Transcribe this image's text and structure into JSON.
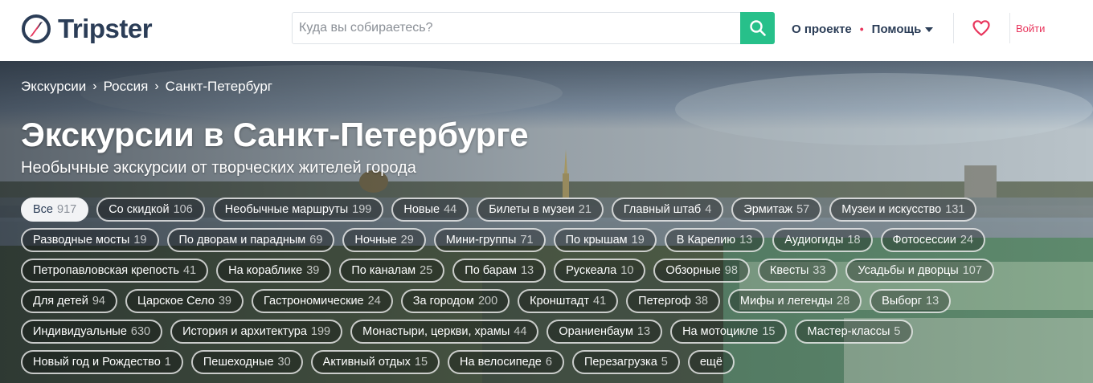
{
  "header": {
    "logo_text": "Tripster",
    "search_placeholder": "Куда вы собираетесь?",
    "nav": {
      "about": "О проекте",
      "help": "Помощь"
    },
    "login": "Войти"
  },
  "colors": {
    "accent_green": "#27c08a",
    "accent_red": "#e8365d",
    "brand_dark": "#2b3d57"
  },
  "breadcrumb": [
    "Экскурсии",
    "Россия",
    "Санкт-Петербург"
  ],
  "title": "Экскурсии в Санкт-Петербурге",
  "subtitle": "Необычные экскурсии от творческих жителей города",
  "tag_rows": [
    [
      {
        "label": "Все",
        "count": "917",
        "active": true
      },
      {
        "label": "Со скидкой",
        "count": "106"
      },
      {
        "label": "Необычные маршруты",
        "count": "199"
      },
      {
        "label": "Новые",
        "count": "44"
      },
      {
        "label": "Билеты в музеи",
        "count": "21"
      },
      {
        "label": "Главный штаб",
        "count": "4"
      },
      {
        "label": "Эрмитаж",
        "count": "57"
      },
      {
        "label": "Музеи и искусство",
        "count": "131"
      }
    ],
    [
      {
        "label": "Разводные мосты",
        "count": "19"
      },
      {
        "label": "По дворам и парадным",
        "count": "69"
      },
      {
        "label": "Ночные",
        "count": "29"
      },
      {
        "label": "Мини-группы",
        "count": "71"
      },
      {
        "label": "По крышам",
        "count": "19"
      },
      {
        "label": "В Карелию",
        "count": "13"
      },
      {
        "label": "Аудиогиды",
        "count": "18"
      },
      {
        "label": "Фотосессии",
        "count": "24"
      }
    ],
    [
      {
        "label": "Петропавловская крепость",
        "count": "41"
      },
      {
        "label": "На кораблике",
        "count": "39"
      },
      {
        "label": "По каналам",
        "count": "25"
      },
      {
        "label": "По барам",
        "count": "13"
      },
      {
        "label": "Рускеала",
        "count": "10"
      },
      {
        "label": "Обзорные",
        "count": "98"
      },
      {
        "label": "Квесты",
        "count": "33"
      },
      {
        "label": "Усадьбы и дворцы",
        "count": "107"
      }
    ],
    [
      {
        "label": "Для детей",
        "count": "94"
      },
      {
        "label": "Царское Село",
        "count": "39"
      },
      {
        "label": "Гастрономические",
        "count": "24"
      },
      {
        "label": "За городом",
        "count": "200"
      },
      {
        "label": "Кронштадт",
        "count": "41"
      },
      {
        "label": "Петергоф",
        "count": "38"
      },
      {
        "label": "Мифы и легенды",
        "count": "28"
      },
      {
        "label": "Выборг",
        "count": "13"
      }
    ],
    [
      {
        "label": "Индивидуальные",
        "count": "630"
      },
      {
        "label": "История и архитектура",
        "count": "199"
      },
      {
        "label": "Монастыри, церкви, храмы",
        "count": "44"
      },
      {
        "label": "Ораниенбаум",
        "count": "13"
      },
      {
        "label": "На мотоцикле",
        "count": "15"
      },
      {
        "label": "Мастер-классы",
        "count": "5"
      }
    ],
    [
      {
        "label": "Новый год и Рождество",
        "count": "1"
      },
      {
        "label": "Пешеходные",
        "count": "30"
      },
      {
        "label": "Активный отдых",
        "count": "15"
      },
      {
        "label": "На велосипеде",
        "count": "6"
      },
      {
        "label": "Перезагрузка",
        "count": "5"
      },
      {
        "label": "ещё",
        "count": ""
      }
    ]
  ]
}
